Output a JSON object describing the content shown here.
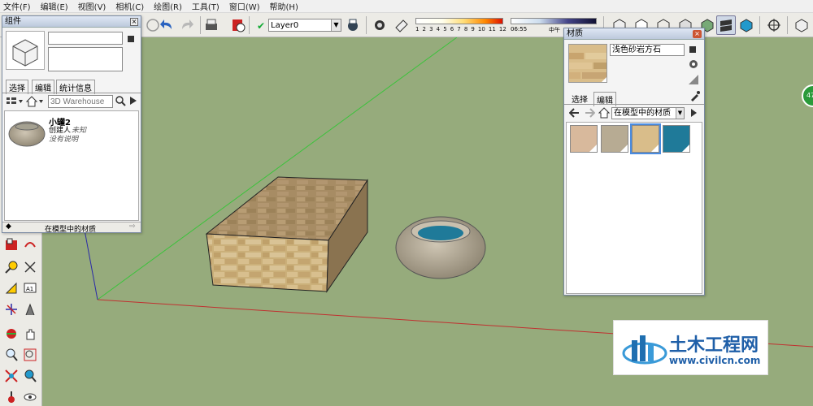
{
  "menu": [
    "文件(F)",
    "编辑(E)",
    "视图(V)",
    "相机(C)",
    "绘图(R)",
    "工具(T)",
    "窗口(W)",
    "帮助(H)"
  ],
  "toolbar": {
    "layer_check": "✔",
    "layer_value": "Layer0",
    "shadow_ticks": [
      "1",
      "2",
      "3",
      "4",
      "5",
      "6",
      "7",
      "8",
      "9",
      "10",
      "11",
      "12"
    ],
    "time_start": "06:55",
    "time_noon": "中午"
  },
  "components_panel": {
    "title": "组件",
    "tabs": [
      "选择",
      "编辑",
      "统计信息"
    ],
    "search_placeholder": "3D Warehouse",
    "item": {
      "name": "小罐2",
      "creator_label": "创建人",
      "creator_value": "未知",
      "description": "没有说明"
    },
    "footer": "在模型中的材质"
  },
  "materials_panel": {
    "title": "材质",
    "material_name": "浅色砂岩方石",
    "tabs": [
      "选择",
      "编辑"
    ],
    "dropdown": "在模型中的材质",
    "swatches": [
      {
        "name": "tan",
        "color": "#d8b99c"
      },
      {
        "name": "stone",
        "color": "#b7ab93"
      },
      {
        "name": "sandstone",
        "color": "#d9bd8a"
      },
      {
        "name": "water",
        "color": "#1f7a99"
      }
    ]
  },
  "watermark": {
    "title": "土木工程网",
    "url": "www.civilcn.com"
  },
  "badge": "47",
  "colors": {
    "viewport": "#96ab7c",
    "axis_green": "#3cc23c",
    "axis_red": "#c03030",
    "axis_blue": "#2a2aa8"
  }
}
